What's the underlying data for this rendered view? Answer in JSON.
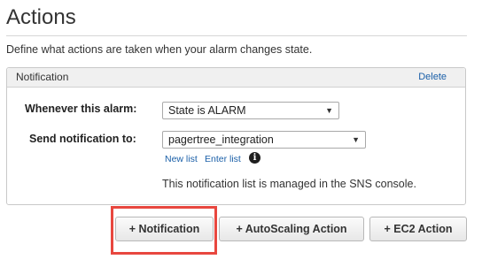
{
  "page": {
    "title": "Actions",
    "description": "Define what actions are taken when your alarm changes state."
  },
  "notification_panel": {
    "header": "Notification",
    "delete_label": "Delete",
    "whenever_label": "Whenever this alarm:",
    "state_value": "State is ALARM",
    "send_label": "Send notification to:",
    "topic_value": "pagertree_integration",
    "new_list_label": "New list",
    "enter_list_label": "Enter list",
    "info_glyph": "i",
    "managed_note": "This notification list is managed in the SNS console."
  },
  "buttons": {
    "add_notification": "+ Notification",
    "add_autoscaling": "+ AutoScaling Action",
    "add_ec2": "+ EC2 Action"
  },
  "icons": {
    "dropdown": "triangle-down",
    "info": "info-circle"
  },
  "colors": {
    "link": "#1a5fa8",
    "highlight": "#e8473f",
    "panel_header_bg": "#f0f0f0"
  }
}
